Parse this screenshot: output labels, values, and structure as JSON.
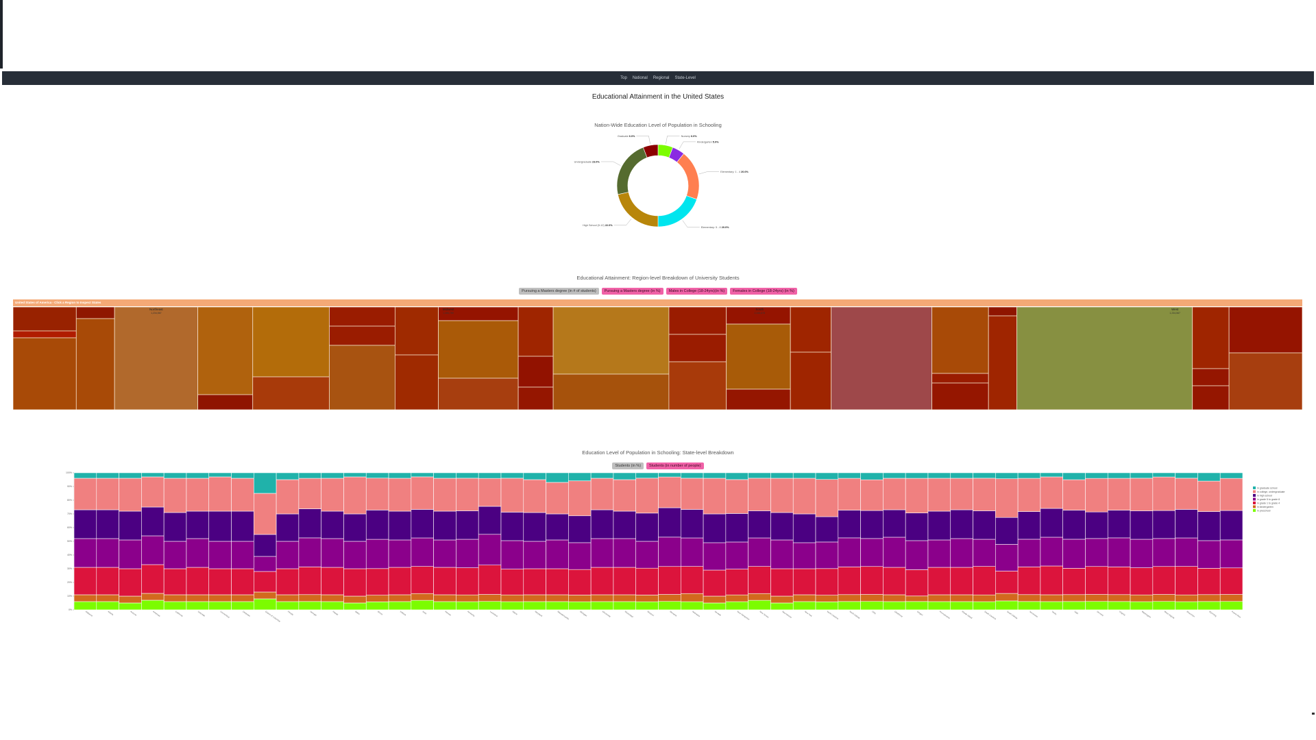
{
  "nav": [
    "Top",
    "National",
    "Regional",
    "State-Level"
  ],
  "page_title": "Educational Attainment in the United States",
  "donut": {
    "title": "Nation-Wide Education Level of Population in Schooling",
    "chart_data": {
      "type": "pie",
      "slices": [
        {
          "label": "Nursery",
          "value": 6.0,
          "text": "6.0%",
          "color": "#7cfc00"
        },
        {
          "label": "Kindergarten",
          "value": 5.0,
          "text": "5.0%",
          "color": "#8a2be2"
        },
        {
          "label": "Elementary: 1 - 4",
          "value": 20.0,
          "text": "20.0%",
          "color": "#ff7f50"
        },
        {
          "label": "Elementary: 5 - 8",
          "value": 20.0,
          "text": "20.0%",
          "color": "#00e5ee"
        },
        {
          "label": "High School (9-12)",
          "value": 22.0,
          "text": "22.0%",
          "color": "#b8860b"
        },
        {
          "label": "Undergraduate",
          "value": 23.0,
          "text": "23.0%",
          "color": "#556b2f"
        },
        {
          "label": "Graduate",
          "value": 6.0,
          "text": "6.0%",
          "color": "#8b0000"
        }
      ]
    }
  },
  "region_section": {
    "title": "Educational Attainment: Region-level Breakdown of University Students",
    "buttons": [
      "Pursuing a Masters degree (in # of students)",
      "Pursuing a Masters degree (in %)",
      "Males in College (18-24yrs)(in %)",
      "Females in College (18-24yrs) (in %)"
    ],
    "treemap_header": "United States of America - Click a Region to Inspect States",
    "region_labels": [
      {
        "name": "Northeast",
        "value": "1,234,567"
      },
      {
        "name": "Midwest",
        "value": "1,456,789"
      },
      {
        "name": "South",
        "value": "2,345,678"
      },
      {
        "name": "West",
        "value": "1,234,567"
      }
    ]
  },
  "state_section": {
    "title": "Education Level of Population in Schooling: State-level Breakdown",
    "buttons": [
      "Students (in %)",
      "Students (in number of people)"
    ],
    "chart_data": {
      "type": "bar",
      "stacked": true,
      "ylim": [
        0,
        100
      ],
      "yticks": [
        "0%",
        "10%",
        "20%",
        "30%",
        "40%",
        "50%",
        "60%",
        "70%",
        "80%",
        "90%",
        "100%"
      ],
      "categories": [
        "Alabama",
        "Alaska",
        "Arizona",
        "Arkansas",
        "California",
        "Colorado",
        "Connecticut",
        "Delaware",
        "District of Columbia",
        "Florida",
        "Georgia",
        "Hawaii",
        "Idaho",
        "Illinois",
        "Indiana",
        "Iowa",
        "Kansas",
        "Kentucky",
        "Louisiana",
        "Maine",
        "Maryland",
        "Massachusetts",
        "Michigan",
        "Minnesota",
        "Mississippi",
        "Missouri",
        "Montana",
        "Nebraska",
        "Nevada",
        "New Hampshire",
        "New Jersey",
        "New Mexico",
        "New York",
        "North Carolina",
        "North Dakota",
        "Ohio",
        "Oklahoma",
        "Oregon",
        "Pennsylvania",
        "Rhode Island",
        "South Carolina",
        "South Dakota",
        "Tennessee",
        "Texas",
        "Utah",
        "Vermont",
        "Virginia",
        "Washington",
        "West Virginia",
        "Wisconsin",
        "Wyoming",
        "Puerto Rico"
      ],
      "series": [
        {
          "name": "in preschool",
          "color": "#7cfc00",
          "values": [
            6,
            6,
            5,
            7,
            6,
            6,
            6,
            6,
            8,
            6,
            6,
            6,
            5,
            6,
            6,
            7,
            6,
            6,
            6,
            6,
            6,
            6,
            6,
            6,
            6,
            6,
            6,
            6,
            5,
            6,
            7,
            5,
            6,
            6,
            6,
            6,
            6,
            6,
            6,
            6,
            6,
            6,
            6,
            6,
            6,
            6,
            6,
            6,
            6,
            6,
            6,
            6
          ]
        },
        {
          "name": "in kindergarten",
          "color": "#d2691e",
          "values": [
            5,
            5,
            5,
            5,
            5,
            5,
            5,
            5,
            5,
            5,
            5,
            5,
            5,
            5,
            5,
            5,
            5,
            5,
            5,
            5,
            5,
            5,
            5,
            5,
            5,
            5,
            5,
            6,
            5,
            5,
            5,
            5,
            5,
            5,
            5,
            5,
            5,
            4,
            5,
            5,
            5,
            5,
            5,
            5,
            5,
            5,
            5,
            5,
            5,
            5,
            5,
            5
          ]
        },
        {
          "name": "in grade 1 to grade 4",
          "color": "#dc143c",
          "values": [
            20,
            20,
            20,
            21,
            19,
            20,
            19,
            19,
            15,
            19,
            20,
            20,
            20,
            20,
            20,
            20,
            20,
            20,
            21,
            19,
            19,
            19,
            19,
            20,
            20,
            20,
            20,
            20,
            19,
            19,
            20,
            20,
            19,
            20,
            20,
            20,
            20,
            19,
            20,
            20,
            21,
            15,
            20,
            21,
            19,
            20,
            20,
            20,
            20,
            21,
            19,
            19
          ]
        },
        {
          "name": "in grade 5 to grade 8",
          "color": "#8b008b",
          "values": [
            21,
            21,
            21,
            21,
            20,
            21,
            20,
            20,
            11,
            20,
            21,
            21,
            20,
            22,
            20,
            21,
            20,
            21,
            22,
            21,
            20,
            21,
            20,
            21,
            21,
            20,
            21,
            21,
            20,
            20,
            21,
            21,
            19,
            20,
            21,
            20,
            22,
            21,
            20,
            21,
            20,
            18,
            20,
            21,
            21,
            20,
            21,
            21,
            20,
            21,
            20,
            20
          ]
        },
        {
          "name": "in high school",
          "color": "#4b0082",
          "values": [
            21,
            21,
            21,
            21,
            21,
            20,
            22,
            22,
            16,
            20,
            21,
            20,
            20,
            22,
            21,
            21,
            21,
            21,
            20,
            21,
            21,
            19,
            20,
            21,
            20,
            21,
            21,
            21,
            21,
            21,
            20,
            20,
            21,
            19,
            20,
            20,
            20,
            20,
            21,
            21,
            21,
            18,
            20,
            21,
            21,
            19,
            20,
            21,
            20,
            21,
            21,
            21
          ]
        },
        {
          "name": "in college, undergraduate",
          "color": "#f08080",
          "values": [
            23,
            23,
            24,
            22,
            25,
            24,
            25,
            24,
            30,
            25,
            22,
            24,
            27,
            24,
            24,
            24,
            24,
            24,
            20,
            25,
            24,
            23,
            26,
            23,
            23,
            26,
            22,
            23,
            26,
            25,
            24,
            25,
            26,
            28,
            23,
            22,
            23,
            25,
            24,
            23,
            24,
            26,
            24,
            23,
            22,
            24,
            23,
            24,
            24,
            23,
            22,
            23
          ]
        },
        {
          "name": "in graduate school",
          "color": "#20b2aa",
          "values": [
            4,
            4,
            4,
            3,
            4,
            4,
            3,
            4,
            15,
            5,
            4,
            4,
            3,
            4,
            4,
            3,
            4,
            4,
            4,
            4,
            5,
            7,
            6,
            4,
            5,
            4,
            3,
            4,
            4,
            5,
            4,
            4,
            4,
            5,
            4,
            5,
            4,
            4,
            4,
            4,
            4,
            4,
            4,
            3,
            5,
            4,
            4,
            4,
            3,
            4,
            6,
            4
          ]
        }
      ]
    }
  }
}
